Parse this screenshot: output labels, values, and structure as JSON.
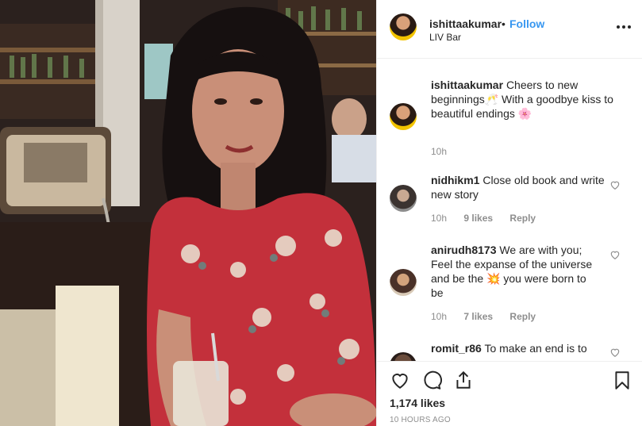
{
  "post": {
    "username": "ishittaakumar",
    "separator": "•",
    "follow_label": "Follow",
    "location": "LIV Bar",
    "likes_text": "1,174 likes",
    "time_ago": "10 HOURS AGO"
  },
  "caption": {
    "username": "ishittaakumar",
    "text": "Cheers to new beginnings🥂 With a goodbye kiss to beautiful endings 🌸",
    "time": "10h"
  },
  "comments": [
    {
      "username": "nidhikm1",
      "text": "Close old book and write new story",
      "time": "10h",
      "likes": "9 likes",
      "reply": "Reply"
    },
    {
      "username": "anirudh8173",
      "text": "We are with you; Feel the expanse of the universe and be the 💥 you were born to be",
      "time": "10h",
      "likes": "7 likes",
      "reply": "Reply"
    },
    {
      "username": "romit_r86",
      "text": "To make an end is to"
    }
  ],
  "icons": [
    "more-icon",
    "heart-icon",
    "comment-icon",
    "share-icon",
    "bookmark-icon"
  ],
  "colors": {
    "follow": "#3897f0",
    "text": "#262626",
    "muted": "#8e8e8e",
    "divider": "#efefef"
  }
}
